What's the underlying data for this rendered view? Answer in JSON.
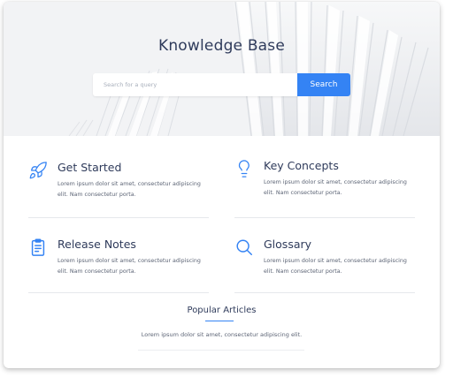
{
  "hero": {
    "title": "Knowledge Base",
    "search_placeholder": "Search for a query",
    "search_button": "Search"
  },
  "topics": [
    {
      "icon": "rocket-icon",
      "title": "Get Started",
      "description": "Lorem ipsum dolor sit amet, consectetur adipiscing elit. Nam consectetur porta."
    },
    {
      "icon": "lightbulb-icon",
      "title": "Key Concepts",
      "description": "Lorem ipsum dolor sit amet, consectetur adipiscing elit. Nam consectetur porta."
    },
    {
      "icon": "clipboard-icon",
      "title": "Release Notes",
      "description": "Lorem ipsum dolor sit amet, consectetur adipiscing elit. Nam consectetur porta."
    },
    {
      "icon": "search-icon",
      "title": "Glossary",
      "description": "Lorem ipsum dolor sit amet, consectetur adipiscing elit. Nam consectetur porta."
    }
  ],
  "popular": {
    "title": "Popular Articles",
    "items": [
      "Lorem ipsum dolor sit amet, consectetur adipiscing elit."
    ]
  },
  "colors": {
    "accent": "#3483f4",
    "heading": "#2f3b5b",
    "text": "#5c6475",
    "hero_bg": "#f3f4f5"
  }
}
